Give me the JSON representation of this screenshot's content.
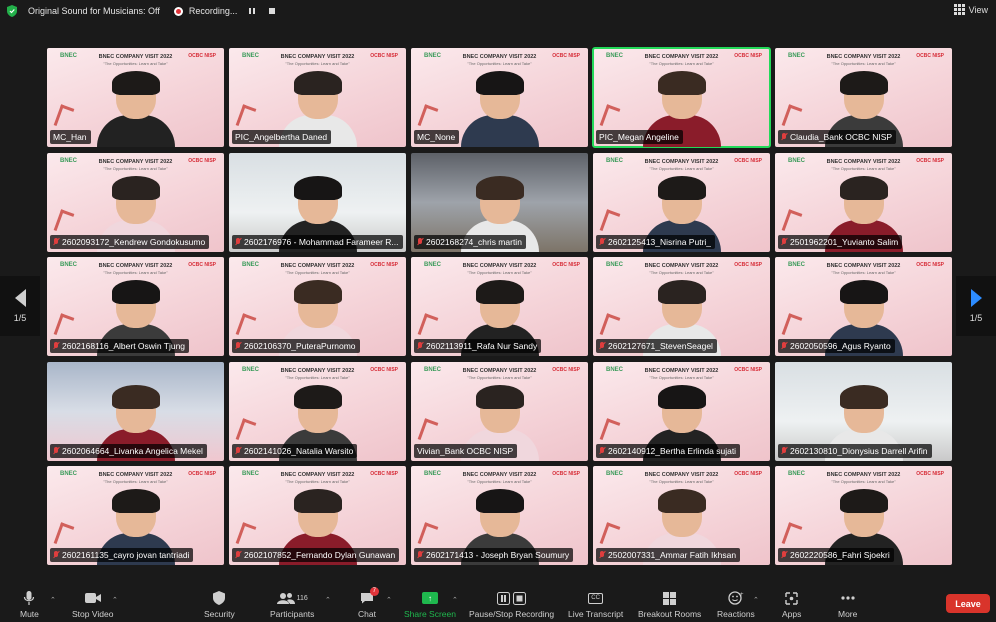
{
  "topbar": {
    "original_sound": "Original Sound for Musicians: Off",
    "recording_status": "Recording...",
    "view_label": "View"
  },
  "pagination": {
    "left_label": "1/5",
    "right_label": "1/5"
  },
  "banner": {
    "logo": "BNEC",
    "title": "BNEC COMPANY VISIT 2022",
    "subtitle": "\"The Opportunities: Learn and Take\"",
    "brand": "OCBC NISP"
  },
  "participants": [
    {
      "name": "MC_Han",
      "muted": false,
      "bg": "pink"
    },
    {
      "name": "PIC_Angelbertha Daned",
      "muted": false,
      "bg": "pink"
    },
    {
      "name": "MC_None",
      "muted": false,
      "bg": "pink"
    },
    {
      "name": "PIC_Megan Angeline",
      "muted": false,
      "bg": "pink",
      "active": true
    },
    {
      "name": "Claudia_Bank OCBC NISP",
      "muted": true,
      "bg": "pink"
    },
    {
      "name": "2602093172_Kendrew Gondokusumo",
      "muted": true,
      "bg": "pink"
    },
    {
      "name": "2602176976 - Mohammad Farameer R...",
      "muted": true,
      "bg": "wall"
    },
    {
      "name": "2602168274_chris martin",
      "muted": true,
      "bg": "office"
    },
    {
      "name": "2602125413_Nisrina Putri_",
      "muted": true,
      "bg": "pink"
    },
    {
      "name": "2501962201_Yuvianto Salim",
      "muted": true,
      "bg": "pink"
    },
    {
      "name": "2602168116_Albert Oswin Tjung",
      "muted": true,
      "bg": "pink"
    },
    {
      "name": "2602106370_PuteraPurnomo",
      "muted": true,
      "bg": "pink"
    },
    {
      "name": "2602113911_Rafa Nur Sandy",
      "muted": true,
      "bg": "pink"
    },
    {
      "name": "2602127671_StevenSeagel",
      "muted": true,
      "bg": "pink"
    },
    {
      "name": "2602050596_Agus Ryanto",
      "muted": true,
      "bg": "pink"
    },
    {
      "name": "2602064664_Livanka Angelica Mekel",
      "muted": true,
      "bg": "blue"
    },
    {
      "name": "2602141026_Natalia Warsito",
      "muted": true,
      "bg": "pink"
    },
    {
      "name": "Vivian_Bank OCBC NISP",
      "muted": false,
      "bg": "pink"
    },
    {
      "name": "2602140912_Bertha Erlinda sujati",
      "muted": true,
      "bg": "pink"
    },
    {
      "name": "2602130810_Dionysius Darrell Arifin",
      "muted": true,
      "bg": "wall"
    },
    {
      "name": "2602161135_cayro jovan tantriadi",
      "muted": true,
      "bg": "pink"
    },
    {
      "name": "2602107852_Fernando Dylan Gunawan",
      "muted": true,
      "bg": "pink"
    },
    {
      "name": "2602171413 - Joseph Bryan Soumury",
      "muted": true,
      "bg": "pink"
    },
    {
      "name": "2502007331_Ammar Fatih Ikhsan",
      "muted": true,
      "bg": "pink"
    },
    {
      "name": "2602220586_Fahri Sjoekri",
      "muted": true,
      "bg": "pink"
    }
  ],
  "toolbar": {
    "mute": "Mute",
    "stop_video": "Stop Video",
    "security": "Security",
    "participants": "Participants",
    "participants_count": "116",
    "chat": "Chat",
    "chat_badge": "7",
    "share_screen": "Share Screen",
    "pause_recording": "Pause/Stop Recording",
    "live_transcript": "Live Transcript",
    "breakout_rooms": "Breakout Rooms",
    "reactions": "Reactions",
    "apps": "Apps",
    "more": "More",
    "leave": "Leave",
    "cc_icon_text": "CC"
  },
  "colors": {
    "active_speaker": "#23d959",
    "share_green": "#1fb84e",
    "leave_red": "#d9342b",
    "muted_red": "#e03e3e",
    "nav_blue": "#2d8cff"
  }
}
